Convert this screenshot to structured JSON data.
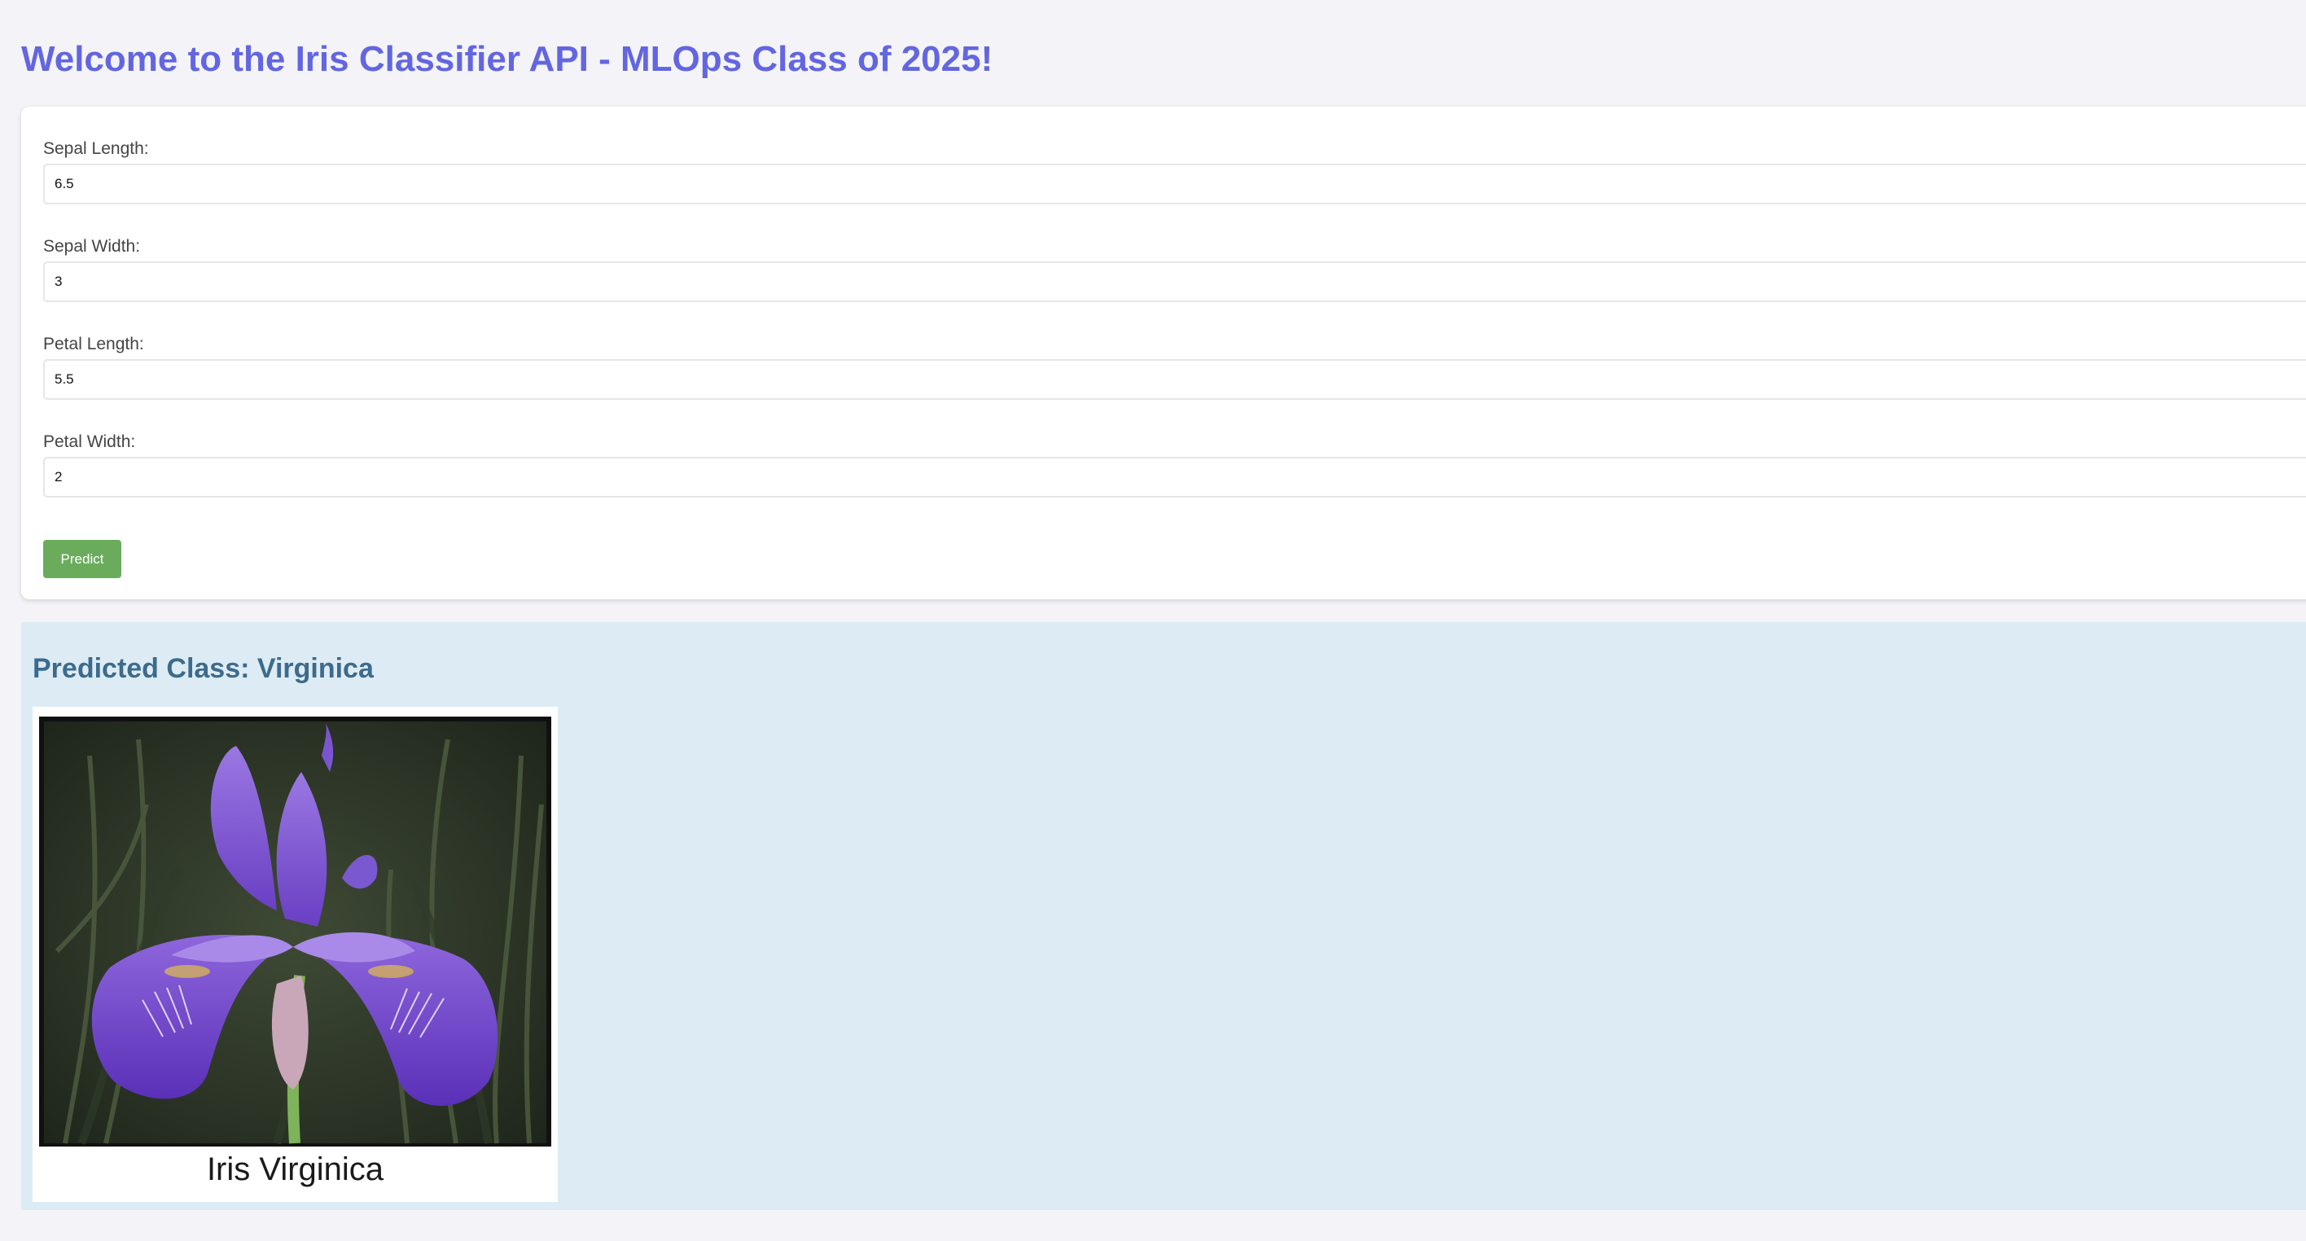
{
  "page": {
    "title": "Welcome to the Iris Classifier API - MLOps Class of 2025!"
  },
  "form": {
    "fields": [
      {
        "label": "Sepal Length:",
        "value": "6.5"
      },
      {
        "label": "Sepal Width:",
        "value": "3"
      },
      {
        "label": "Petal Length:",
        "value": "5.5"
      },
      {
        "label": "Petal Width:",
        "value": "2"
      }
    ],
    "submit_label": "Predict"
  },
  "result": {
    "heading": "Predicted Class: Virginica",
    "image_caption": "Iris Virginica",
    "image_icon": "iris-flower-photo"
  },
  "colors": {
    "title": "#6366e0",
    "button": "#6aac5c",
    "result_background": "#ddecf4",
    "result_heading": "#3d6b8d"
  }
}
